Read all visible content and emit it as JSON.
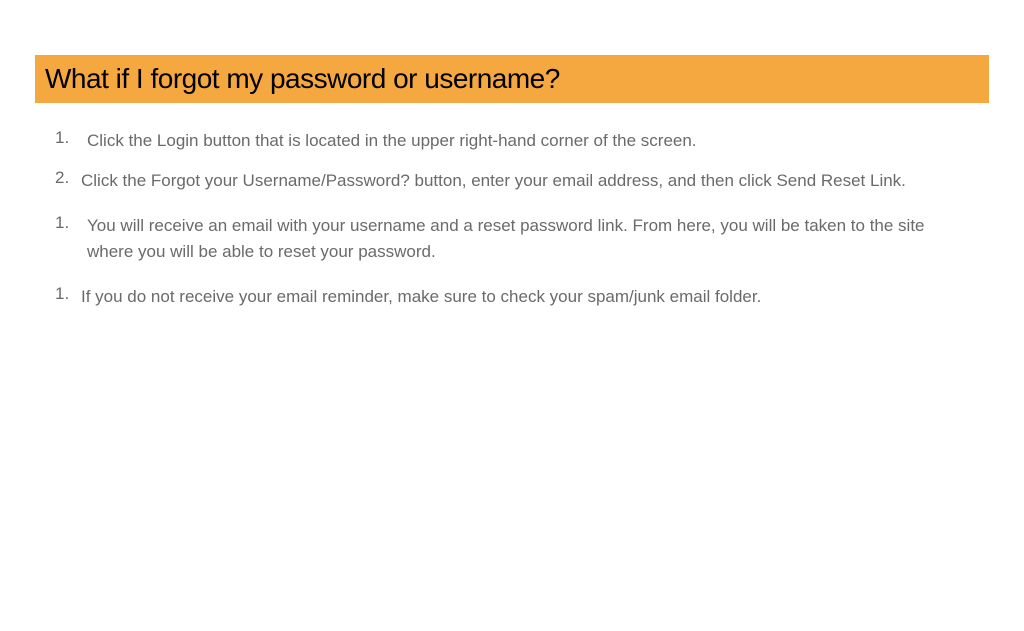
{
  "title": "What if I forgot my password or username?",
  "steps": [
    {
      "num": "1.",
      "text": "Click the Login button that is located in the upper right-hand corner of the screen."
    },
    {
      "num": "2.",
      "text": "Click the Forgot your Username/Password? button, enter your email address, and then click Send Reset Link."
    },
    {
      "num": "1.",
      "text": "You will receive an email with your username and a reset password link. From here, you will be taken to the site where you will be able to reset your password."
    },
    {
      "num": "1.",
      "text": "If you do not receive your email reminder, make sure to check your spam/junk email folder."
    }
  ]
}
